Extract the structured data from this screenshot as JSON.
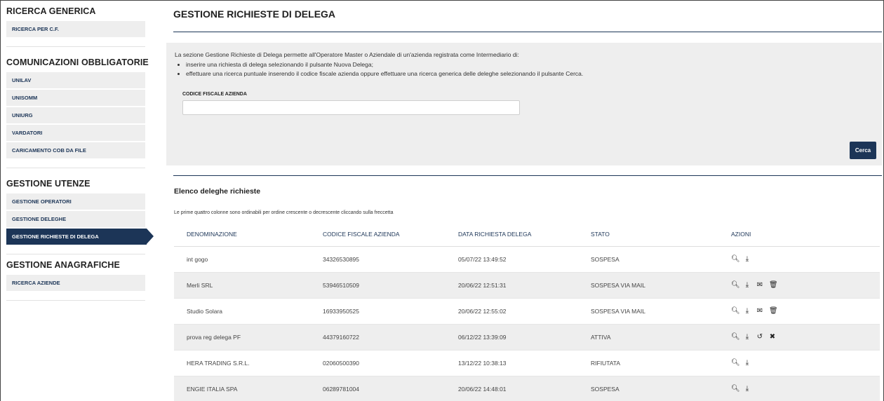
{
  "sidebar": {
    "sections": [
      {
        "title": "RICERCA GENERICA",
        "items": [
          "RICERCA PER C.F."
        ]
      },
      {
        "title": "COMUNICAZIONI OBBLIGATORIE",
        "items": [
          "UNILAV",
          "UNISOMM",
          "UNIURG",
          "VARDATORI",
          "CARICAMENTO COB DA FILE"
        ]
      },
      {
        "title": "GESTIONE UTENZE",
        "items": [
          "GESTIONE OPERATORI",
          "GESTIONE DELEGHE",
          "GESTIONE RICHIESTE DI DELEGA"
        ]
      },
      {
        "title": "GESTIONE ANAGRAFICHE",
        "items": [
          "RICERCA AZIENDE"
        ]
      }
    ]
  },
  "main": {
    "title": "GESTIONE RICHIESTE DI DELEGA",
    "info": {
      "intro": "La sezione Gestione Richieste di Delega permette all'Operatore Master o Aziendale di un'azienda registrata come Intermediario di:",
      "bullets": [
        "inserire una richiesta di delega selezionando il pulsante Nuova Delega;",
        "effettuare una ricerca puntuale inserendo il codice fiscale azienda oppure effettuare una ricerca generica delle deleghe selezionando il pulsante Cerca."
      ],
      "field_label": "CODICE FISCALE AZIENDA",
      "field_value": "",
      "search_button": "Cerca"
    },
    "list_title": "Elenco deleghe richieste",
    "list_note": "Le prime quattro colonne sono ordinabili per ordine crescente o decrescente cliccando sulla freccetta",
    "columns": [
      "DENOMINAZIONE",
      "CODICE FISCALE AZIENDA",
      "DATA RICHIESTA DELEGA",
      "STATO",
      "AZIONI"
    ],
    "rows": [
      {
        "name": "int gogo",
        "cf": "34326530895",
        "date": "05/07/22 13:49:52",
        "status": "SOSPESA",
        "actions": [
          "search-icon",
          "download-icon"
        ]
      },
      {
        "name": "Merli SRL",
        "cf": "53946510509",
        "date": "20/06/22 12:51:31",
        "status": "SOSPESA VIA MAIL",
        "actions": [
          "search-icon",
          "download-icon",
          "mail-icon",
          "trash-icon"
        ]
      },
      {
        "name": "Studio Solara",
        "cf": "16933950525",
        "date": "20/06/22 12:55:02",
        "status": "SOSPESA VIA MAIL",
        "actions": [
          "search-icon",
          "download-icon",
          "mail-icon",
          "trash-icon"
        ]
      },
      {
        "name": "prova reg delega PF",
        "cf": "44379160722",
        "date": "06/12/22 13:39:09",
        "status": "ATTIVA",
        "actions": [
          "search-icon",
          "download-icon",
          "revoke-icon",
          "close-icon"
        ]
      },
      {
        "name": "HERA TRADING S.R.L.",
        "cf": "02060500390",
        "date": "13/12/22 10:38:13",
        "status": "RIFIUTATA",
        "actions": [
          "search-icon",
          "download-icon"
        ]
      },
      {
        "name": "ENGIE ITALIA SPA",
        "cf": "06289781004",
        "date": "20/06/22 14:48:01",
        "status": "SOSPESA",
        "actions": [
          "search-icon",
          "download-icon"
        ]
      }
    ]
  },
  "colors": {
    "primary": "#1c3557",
    "panel": "#eeeeee"
  }
}
